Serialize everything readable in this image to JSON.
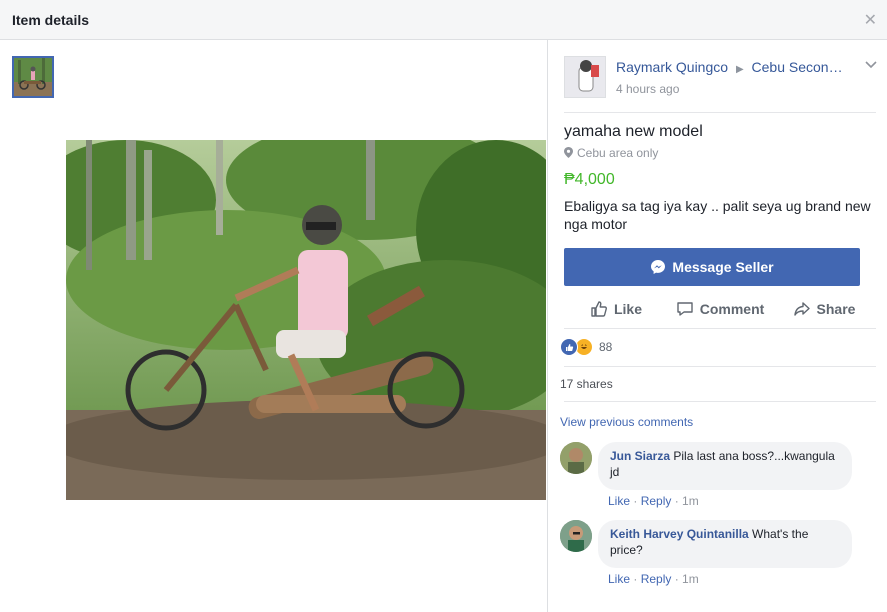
{
  "header": {
    "title": "Item details",
    "close_icon": "close-icon"
  },
  "seller": {
    "name": "Raymark Quingco",
    "group": "Cebu Secon…",
    "time": "4 hours ago"
  },
  "item": {
    "title": "yamaha new model",
    "location": "Cebu area only",
    "price": "₱4,000",
    "description": "Ebaligya sa tag iya kay .. palit seya ug brand new nga motor"
  },
  "buttons": {
    "message_seller": "Message Seller"
  },
  "actions": {
    "like": "Like",
    "comment": "Comment",
    "share": "Share"
  },
  "reactions": {
    "count": "88"
  },
  "shares": "17 shares",
  "view_previous": "View previous comments",
  "comments": [
    {
      "author": "Jun Siarza",
      "text": "Pila last ana boss?...kwangula jd",
      "like": "Like",
      "reply": "Reply",
      "time": "1m"
    },
    {
      "author": "Keith Harvey Quintanilla",
      "text": "What's the price?",
      "like": "Like",
      "reply": "Reply",
      "time": "1m"
    }
  ],
  "colors": {
    "accent": "#4267b2",
    "price": "#42b72a",
    "header_bg": "#f5f6f7"
  }
}
